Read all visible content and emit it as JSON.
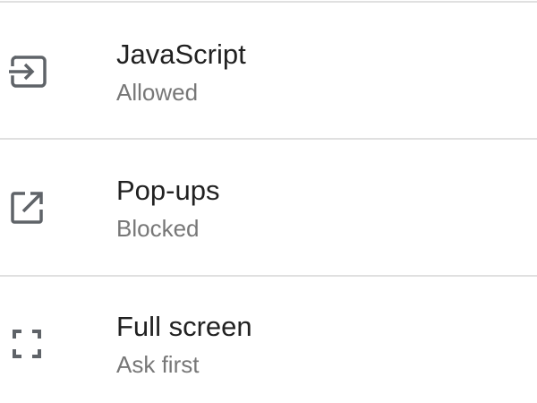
{
  "settings": {
    "items": [
      {
        "icon": "javascript-icon",
        "title": "JavaScript",
        "status": "Allowed"
      },
      {
        "icon": "open-in-new-icon",
        "title": "Pop-ups",
        "status": "Blocked"
      },
      {
        "icon": "fullscreen-icon",
        "title": "Full screen",
        "status": "Ask first"
      }
    ]
  },
  "colors": {
    "title": "#212121",
    "status": "#777777",
    "icon": "#5f6368",
    "divider": "#e0e0e0"
  }
}
